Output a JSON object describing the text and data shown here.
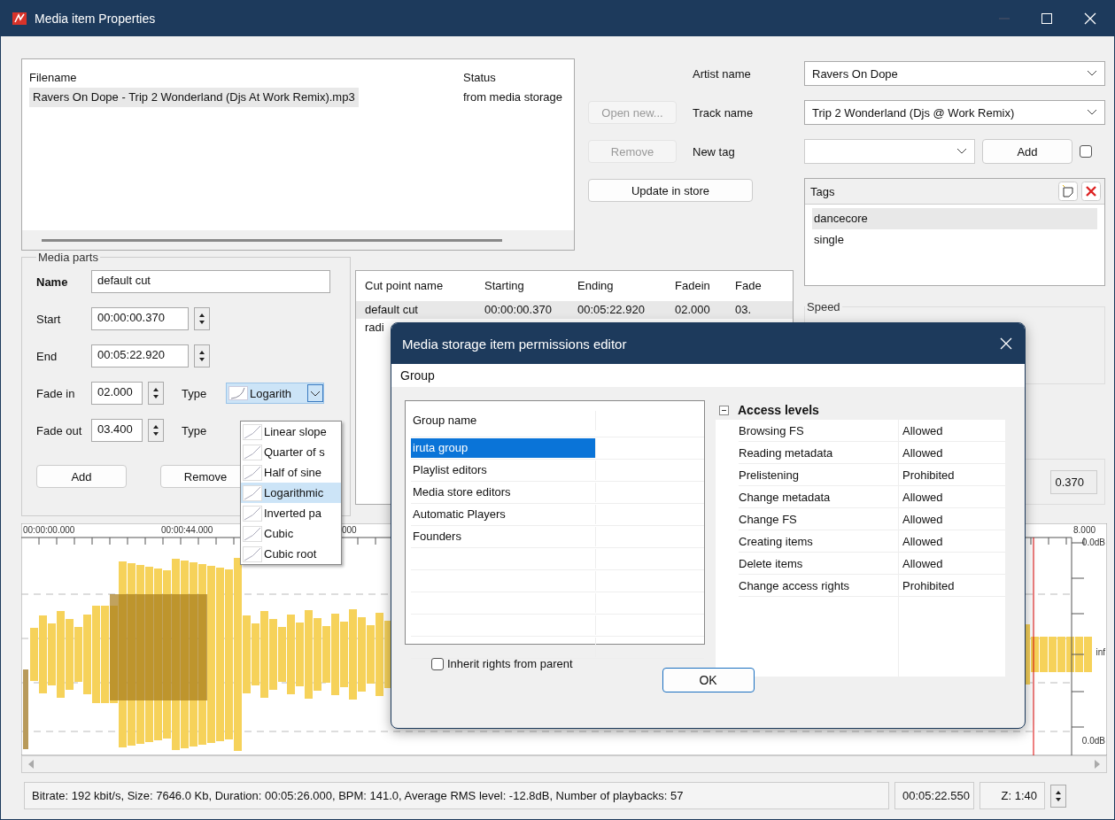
{
  "window": {
    "title": "Media item Properties"
  },
  "file_list": {
    "columns": [
      "Filename",
      "Status"
    ],
    "rows": [
      {
        "filename": "Ravers On Dope - Trip 2 Wonderland (Djs At Work Remix).mp3",
        "status": "from media storage",
        "selected": true
      }
    ]
  },
  "file_buttons": [
    {
      "label": "Open new...",
      "disabled": true
    },
    {
      "label": "Remove",
      "disabled": true
    }
  ],
  "update_button": "Update in store",
  "artist": {
    "label": "Artist name",
    "value": "Ravers On Dope"
  },
  "track": {
    "label": "Track name",
    "value": "Trip 2 Wonderland (Djs @ Work Remix)"
  },
  "new_tag": {
    "label": "New tag",
    "add": "Add",
    "checked": false
  },
  "tags": {
    "title": "Tags",
    "items": [
      {
        "label": "dancecore",
        "selected": true
      },
      {
        "label": "single",
        "selected": false
      }
    ]
  },
  "media_parts": {
    "title": "Media parts",
    "name": {
      "label": "Name",
      "value": "default cut"
    },
    "start": {
      "label": "Start",
      "value": "00:00:00.370"
    },
    "end": {
      "label": "End",
      "value": "00:05:22.920"
    },
    "fade_in": {
      "label": "Fade in",
      "value": "02.000",
      "type_label": "Type",
      "type_value": "Logarith"
    },
    "fade_out": {
      "label": "Fade out",
      "value": "03.400",
      "type_label": "Type"
    },
    "buttons": [
      "Add",
      "Remove"
    ]
  },
  "fade_menu": [
    {
      "label": "Linear slope",
      "selected": false
    },
    {
      "label": "Quarter of s",
      "selected": false
    },
    {
      "label": "Half of sine",
      "selected": false
    },
    {
      "label": "Logarithmic",
      "selected": true
    },
    {
      "label": "Inverted pa",
      "selected": false
    },
    {
      "label": "Cubic",
      "selected": false
    },
    {
      "label": "Cubic root",
      "selected": false
    }
  ],
  "cut_table": {
    "columns": [
      "Cut point name",
      "Starting",
      "Ending",
      "Fadein",
      "Fade"
    ],
    "rows": [
      [
        "default cut",
        "00:00:00.370",
        "00:05:22.920",
        "02.000",
        "03."
      ],
      [
        "radi"
      ]
    ]
  },
  "speed": {
    "title": "Speed"
  },
  "position_field": "0.370",
  "waveform": {
    "time_labels": [
      "00:00:00.000",
      "00:00:44.000",
      "000",
      "8.000"
    ],
    "db_labels": [
      "0.0dB",
      "inf",
      "0.0dB"
    ]
  },
  "status": {
    "info": "Bitrate: 192 kbit/s, Size: 7646.0 Kb, Duration: 00:05:26.000, BPM: 141.0, Average RMS level: -12.8dB, Number of playbacks: 57",
    "time": "00:05:22.550",
    "zoom": "Z: 1:40"
  },
  "dialog": {
    "title": "Media storage item permissions editor",
    "menu": [
      "Group"
    ],
    "group_column": "Group name",
    "groups": [
      {
        "label": "iruta group",
        "selected": true
      },
      {
        "label": "Playlist editors",
        "selected": false
      },
      {
        "label": "Media store editors",
        "selected": false
      },
      {
        "label": "Automatic Players",
        "selected": false
      },
      {
        "label": "Founders",
        "selected": false
      }
    ],
    "access": {
      "title": "Access levels",
      "expanded": true,
      "rows": [
        {
          "name": "Browsing FS",
          "value": "Allowed"
        },
        {
          "name": "Reading metadata",
          "value": "Allowed"
        },
        {
          "name": "Prelistening",
          "value": "Prohibited"
        },
        {
          "name": "Change metadata",
          "value": "Allowed"
        },
        {
          "name": "Change FS",
          "value": "Allowed"
        },
        {
          "name": "Creating items",
          "value": "Allowed"
        },
        {
          "name": "Delete items",
          "value": "Allowed"
        },
        {
          "name": "Change access rights",
          "value": "Prohibited"
        }
      ]
    },
    "inherit": {
      "label": "Inherit rights from parent",
      "checked": false
    },
    "ok": "OK"
  }
}
